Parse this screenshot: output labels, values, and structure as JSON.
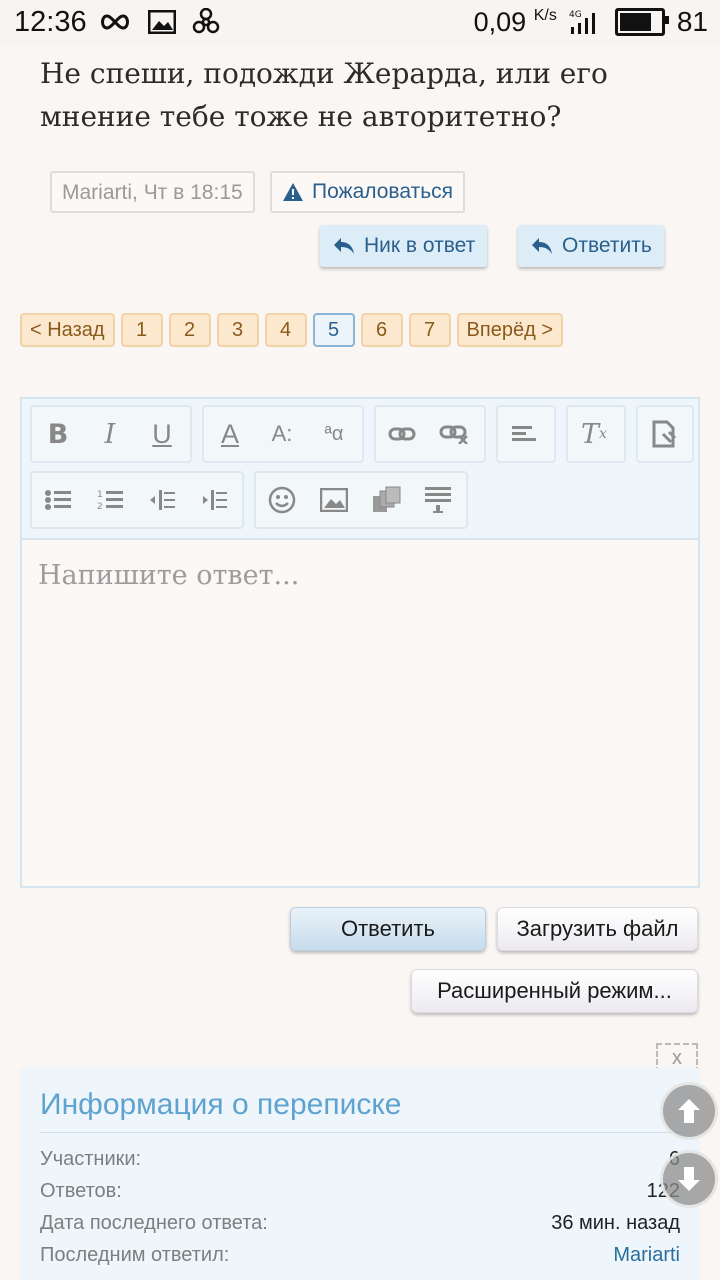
{
  "status_bar": {
    "time": "12:36",
    "speed": "0,09",
    "speed_unit": "K/s",
    "network": "4G",
    "battery": "81",
    "battery_level": 0.81
  },
  "post": {
    "text": "Не спеши, подожди Жерарда, или его мнение тебе тоже не авторитетно?",
    "author": "Mariarti",
    "time": "Чт в 18:15",
    "report_label": "Пожаловаться",
    "nick_reply_label": "Ник в ответ",
    "reply_label": "Ответить"
  },
  "pagination": {
    "prev": "< Назад",
    "pages": [
      "1",
      "2",
      "3",
      "4",
      "5",
      "6",
      "7"
    ],
    "current": "5",
    "next": "Вперёд >"
  },
  "editor": {
    "placeholder": "Напишите ответ...",
    "toolbar_row1": [
      "bold-icon",
      "italic-icon",
      "underline-icon",
      "font-color-icon",
      "font-size-icon",
      "font-family-icon",
      "link-icon",
      "unlink-icon",
      "align-icon",
      "remove-format-icon",
      "source-icon"
    ],
    "toolbar_row2": [
      "bullet-list-icon",
      "numbered-list-icon",
      "outdent-icon",
      "indent-icon",
      "smiley-icon",
      "image-icon",
      "media-icon",
      "insert-block-icon"
    ]
  },
  "actions": {
    "reply": "Ответить",
    "upload": "Загрузить файл",
    "advanced": "Расширенный режим..."
  },
  "close_label": "x",
  "info": {
    "title": "Информация о переписке",
    "rows": [
      {
        "label": "Участники:",
        "value": "6"
      },
      {
        "label": "Ответов:",
        "value": "122"
      },
      {
        "label": "Дата последнего ответа:",
        "value": "36 мин. назад"
      },
      {
        "label": "Последним ответил:",
        "value": "Mariarti"
      }
    ]
  }
}
